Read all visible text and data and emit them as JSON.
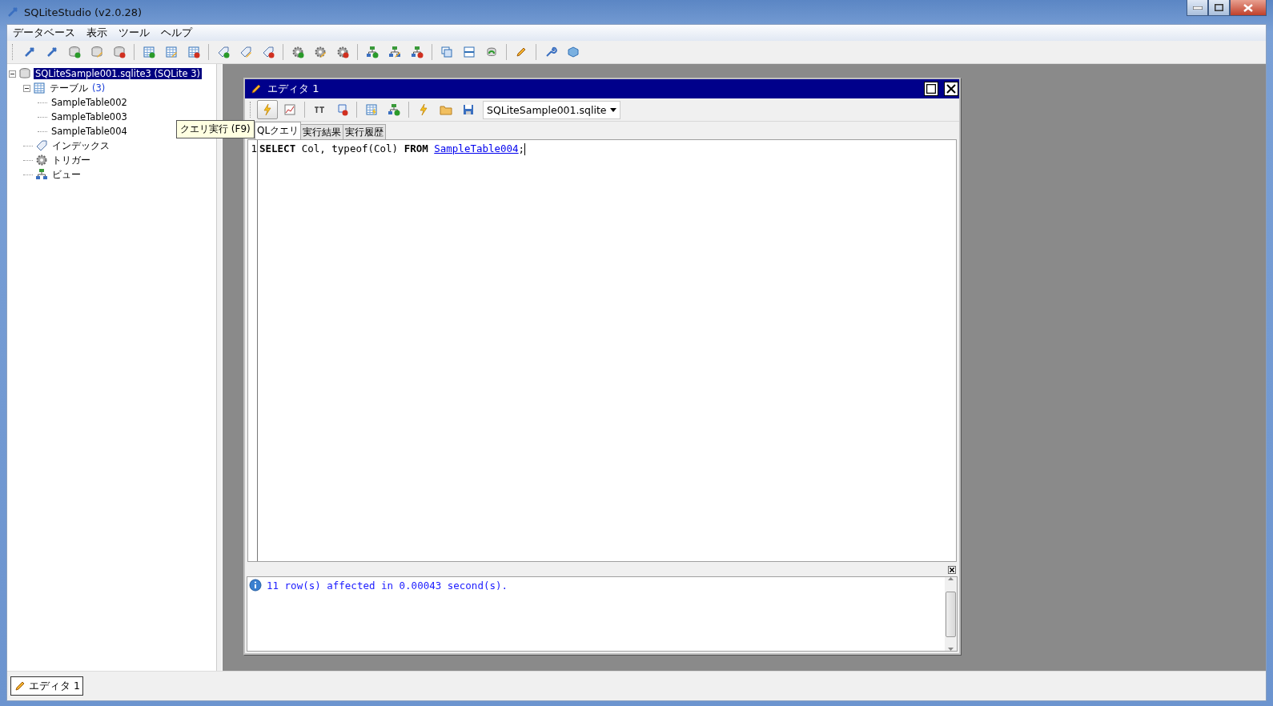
{
  "window": {
    "title": "SQLiteStudio (v2.0.28)"
  },
  "menu": [
    "データベース",
    "表示",
    "ツール",
    "ヘルプ"
  ],
  "tree": {
    "label": "SQLiteSample001.sqlite3",
    "suffix": "(SQLite 3)",
    "selected": true,
    "expanded": true,
    "children": [
      {
        "kind": "tables",
        "label": "テーブル",
        "count": "(3)",
        "expanded": true,
        "children": [
          {
            "label": "SampleTable002"
          },
          {
            "label": "SampleTable003"
          },
          {
            "label": "SampleTable004"
          }
        ]
      },
      {
        "kind": "indexes",
        "label": "インデックス"
      },
      {
        "kind": "triggers",
        "label": "トリガー"
      },
      {
        "kind": "views",
        "label": "ビュー"
      }
    ]
  },
  "editor": {
    "title": "エディタ 1",
    "database": "SQLiteSample001.sqlite",
    "tabs": [
      {
        "label": "QLクエリ",
        "selected": true
      },
      {
        "label": "実行結果",
        "selected": false
      },
      {
        "label": "実行履歴",
        "selected": false
      }
    ],
    "tooltip": "クエリ実行 (F9)",
    "lines": [
      {
        "number": "1",
        "tokens": [
          {
            "kind": "keyword",
            "text": "SELECT"
          },
          {
            "kind": "text",
            "text": " Col, typeof(Col) "
          },
          {
            "kind": "keyword",
            "text": "FROM"
          },
          {
            "kind": "link",
            "text": "SampleTable004"
          },
          {
            "kind": "text",
            "text": ";"
          }
        ]
      }
    ],
    "messages": [
      {
        "kind": "info",
        "text": "11 row(s) affected in 0.00043 second(s)."
      }
    ]
  },
  "taskbar": [
    {
      "label": "エディタ 1",
      "selected": true
    }
  ]
}
